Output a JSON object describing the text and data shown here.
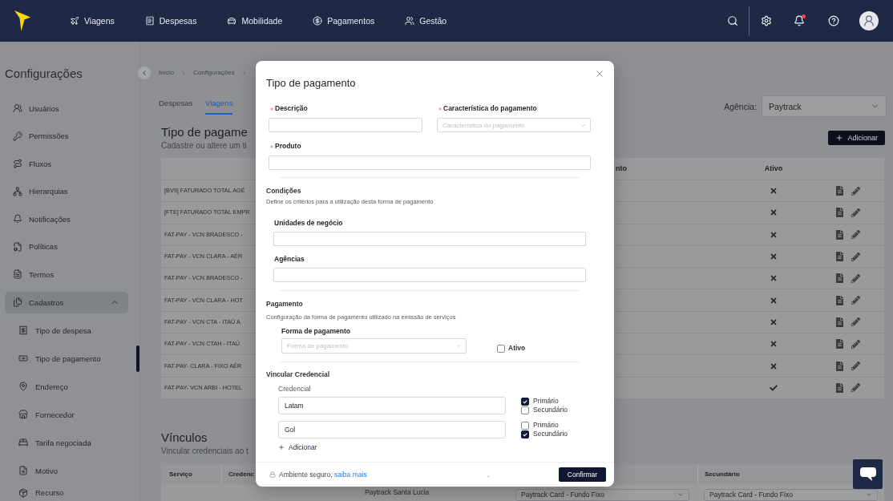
{
  "header": {
    "nav": [
      {
        "label": "Viagens"
      },
      {
        "label": "Despesas"
      },
      {
        "label": "Mobilidade"
      },
      {
        "label": "Pagamentos"
      },
      {
        "label": "Gestão"
      }
    ],
    "notifications_unread": true
  },
  "sidebar": {
    "title": "Configurações",
    "items": [
      {
        "kind": "link",
        "label": "Usuários",
        "selected": false
      },
      {
        "kind": "link",
        "label": "Permissões",
        "selected": false
      },
      {
        "kind": "link",
        "label": "Fluxos",
        "selected": false
      },
      {
        "kind": "link",
        "label": "Hierarquias",
        "selected": false
      },
      {
        "kind": "link",
        "label": "Notificações",
        "selected": false
      },
      {
        "kind": "link",
        "label": "Políticas",
        "selected": false
      },
      {
        "kind": "link",
        "label": "Termos",
        "selected": false
      },
      {
        "kind": "group",
        "label": "Cadastros",
        "selected": false,
        "expanded": true,
        "children": [
          {
            "label": "Tipo de despesa",
            "selected": false
          },
          {
            "label": "Tipo de pagamento",
            "selected": true
          },
          {
            "label": "Endereço",
            "selected": false
          },
          {
            "label": "Fornecedor",
            "selected": false
          },
          {
            "label": "Tarifa negociada",
            "selected": false
          },
          {
            "label": "Motivo",
            "selected": false
          },
          {
            "label": "Recurso",
            "selected": false
          }
        ]
      }
    ]
  },
  "breadcrumb": [
    {
      "label": "Início"
    },
    {
      "label": "Configurações"
    }
  ],
  "tabs": [
    {
      "label": "Despesas",
      "selected": false
    },
    {
      "label": "Viagens",
      "selected": true
    }
  ],
  "agency": {
    "label": "Agência:",
    "value": "Paytrack"
  },
  "payment_types": {
    "title": "Tipo de pagame",
    "subtitle": "Cadastre ou altere um ti",
    "add_button": "Adicionar",
    "columns": [
      "nto",
      "Ativo"
    ],
    "rows": [
      {
        "name": "[BV9] FATURADO TOTAL AGÉ",
        "active": false
      },
      {
        "name": "[FTE] FATURADO TOTAL EMPR",
        "active": false
      },
      {
        "name": "FAT-PAY - VCN BRADESCO -",
        "active": false
      },
      {
        "name": "FAT-PAY - VCN CLARA - AÉR",
        "active": false
      },
      {
        "name": "FAT-PAY - VCN BRADESCO -",
        "active": false
      },
      {
        "name": "FAT-PAY - VCN CLARA - HOT",
        "active": false
      },
      {
        "name": "FAT-PAY - VCN CTA - ITAÚ A",
        "active": false
      },
      {
        "name": "FAT-PAY - VCN CTAH - ITAÚ",
        "active": false
      },
      {
        "name": "FAT-PAY- CLARA - FIXO AÉR",
        "active": false
      },
      {
        "name": "FAT-PAY- VCN ARBI - HOTEL",
        "active": true
      }
    ]
  },
  "links": {
    "title": "Vínculos",
    "subtitle": "Vincular credenciais ao t",
    "columns": [
      "Serviço",
      "Credenc",
      "Secundário"
    ],
    "rows": [
      {
        "column_3": "Paytrack Santa Lucia",
        "column_4": "Paytrack Card - Fundo Fixo",
        "secondary": "Paytrack Card - Fundo Fixo"
      }
    ]
  },
  "modal": {
    "title": "Tipo de pagamento",
    "fields": [
      {
        "kind": "text",
        "label": "Descrição",
        "required": true
      },
      {
        "kind": "select",
        "label": "Característica do pagamento",
        "required": true,
        "placeholder": "Característica do pagamento"
      },
      {
        "kind": "text",
        "label": "Produto",
        "required": true
      }
    ],
    "conditions": {
      "title": "Condições",
      "description": "Define os critérios para a utilização desta forma de pagamento",
      "fields": [
        {
          "label": "Unidades de negócio",
          "required": false
        },
        {
          "label": "Agências",
          "required": false
        }
      ]
    },
    "payment": {
      "title": "Pagamento",
      "description": "Configuração da forma de pagamento utilizado na emissão de serviços",
      "method": {
        "label": "Forma de pagamento",
        "required": false,
        "placeholder": "Forma de pagamento"
      },
      "active": {
        "label": "Ativo",
        "checked": false
      }
    },
    "credentials": {
      "title": "Vincular Credencial",
      "label": "Credencial",
      "items": [
        {
          "value": "Latam",
          "options": [
            {
              "label": "Primário",
              "checked": true
            },
            {
              "label": "Secundário",
              "checked": false
            }
          ]
        },
        {
          "value": "Gol",
          "options": [
            {
              "label": "Primário",
              "checked": false
            },
            {
              "label": "Secundário",
              "checked": true
            }
          ]
        }
      ],
      "add_link": "Adicionar"
    },
    "footer": {
      "note": "Ambiente seguro,",
      "link": "saiba mais",
      "mark": ".",
      "confirm_button": "Confirmar"
    }
  }
}
